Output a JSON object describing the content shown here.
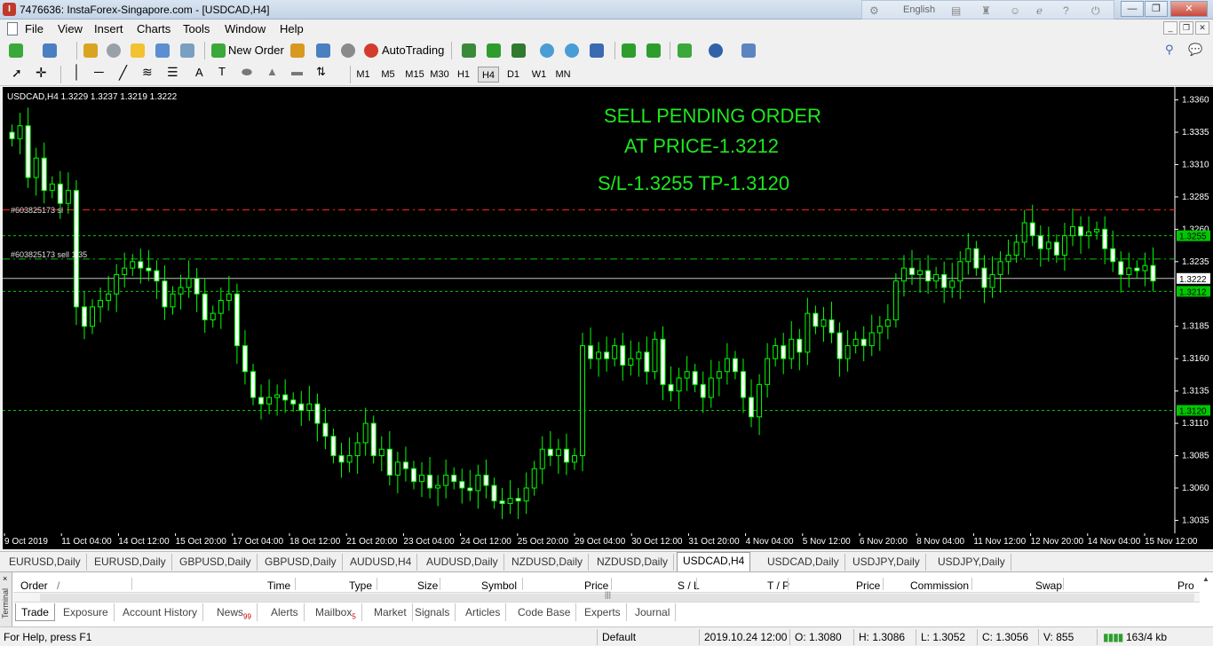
{
  "window": {
    "title": "7476636: InstaForex-Singapore.com - [USDCAD,H4]",
    "language": "English",
    "app_icon_letter": "I"
  },
  "menu": [
    "File",
    "View",
    "Insert",
    "Charts",
    "Tools",
    "Window",
    "Help"
  ],
  "toolbar": {
    "new_order": "New Order",
    "autotrading": "AutoTrading"
  },
  "timeframes": [
    "M1",
    "M5",
    "M15",
    "M30",
    "H1",
    "H4",
    "D1",
    "W1",
    "MN"
  ],
  "active_timeframe": "H4",
  "chart": {
    "symbol_info": "USDCAD,H4  1.3229 1.3237 1.3219 1.3222",
    "annotation_lines": [
      "SELL PENDING ORDER",
      "AT PRICE-1.3212",
      "S/L-1.3255 TP-1.3120"
    ],
    "order_sl_label": "#603825173 sl",
    "order_sell_label": "#603825173 sell 1.35",
    "price_ticks": [
      "1.3360",
      "1.3335",
      "1.3310",
      "1.3285",
      "1.3260",
      "1.3235",
      "1.3185",
      "1.3160",
      "1.3135",
      "1.3110",
      "1.3085",
      "1.3060",
      "1.3035"
    ],
    "price_labels": {
      "sl": "1.3255",
      "current": "1.3222",
      "entry": "1.3212",
      "tp": "1.3120"
    },
    "time_ticks": [
      "9 Oct 2019",
      "11 Oct 04:00",
      "14 Oct 12:00",
      "15 Oct 20:00",
      "17 Oct 04:00",
      "18 Oct 12:00",
      "21 Oct 20:00",
      "23 Oct 04:00",
      "24 Oct 12:00",
      "25 Oct 20:00",
      "29 Oct 04:00",
      "30 Oct 12:00",
      "31 Oct 20:00",
      "4 Nov 04:00",
      "5 Nov 12:00",
      "6 Nov 20:00",
      "8 Nov 04:00",
      "11 Nov 12:00",
      "12 Nov 20:00",
      "14 Nov 04:00",
      "15 Nov 12:00"
    ],
    "colors": {
      "background": "#000000",
      "candle": "#00ff00",
      "sl_line": "#ff2020",
      "level_line": "#00c800",
      "annotation": "#1ee81e",
      "price_line": "#c0c0c0"
    }
  },
  "chart_data": {
    "type": "candlestick",
    "symbol": "USDCAD",
    "timeframe": "H4",
    "levels": {
      "stop_loss": 1.3275,
      "sell_pending": 1.3237,
      "current_bid": 1.3222,
      "entry": 1.3212,
      "green_upper": 1.3255,
      "take_profit": 1.312
    },
    "ylim": [
      1.3025,
      1.337
    ],
    "closes": [
      1.333,
      1.334,
      1.33,
      1.3315,
      1.329,
      1.3295,
      1.328,
      1.329,
      1.32,
      1.3185,
      1.32,
      1.3205,
      1.321,
      1.3225,
      1.323,
      1.3235,
      1.323,
      1.3228,
      1.322,
      1.32,
      1.321,
      1.3215,
      1.3222,
      1.321,
      1.319,
      1.3195,
      1.3205,
      1.321,
      1.317,
      1.315,
      1.313,
      1.3125,
      1.313,
      1.3132,
      1.3128,
      1.3125,
      1.312,
      1.3125,
      1.311,
      1.31,
      1.3085,
      1.308,
      1.3085,
      1.3095,
      1.311,
      1.3085,
      1.309,
      1.307,
      1.308,
      1.3075,
      1.3065,
      1.307,
      1.306,
      1.3062,
      1.307,
      1.3065,
      1.306,
      1.3058,
      1.307,
      1.3062,
      1.305,
      1.3048,
      1.3052,
      1.305,
      1.306,
      1.3075,
      1.309,
      1.3085,
      1.309,
      1.308,
      1.3085,
      1.317,
      1.316,
      1.3165,
      1.316,
      1.317,
      1.3155,
      1.316,
      1.3165,
      1.315,
      1.3175,
      1.314,
      1.3135,
      1.3145,
      1.315,
      1.314,
      1.313,
      1.3145,
      1.315,
      1.316,
      1.315,
      1.313,
      1.3115,
      1.314,
      1.316,
      1.317,
      1.316,
      1.3175,
      1.3165,
      1.3195,
      1.3185,
      1.319,
      1.318,
      1.316,
      1.317,
      1.3175,
      1.317,
      1.318,
      1.3185,
      1.319,
      1.322,
      1.323,
      1.3225,
      1.3228,
      1.322,
      1.3225,
      1.3215,
      1.322,
      1.3235,
      1.3245,
      1.323,
      1.3215,
      1.3225,
      1.3235,
      1.324,
      1.325,
      1.3265,
      1.3255,
      1.3245,
      1.325,
      1.324,
      1.3255,
      1.3262,
      1.3255,
      1.3258,
      1.326,
      1.3245,
      1.3235,
      1.3225,
      1.323,
      1.3228,
      1.3232,
      1.322
    ]
  },
  "chart_tabs": [
    "EURUSD,Daily",
    "EURUSD,Daily",
    "GBPUSD,Daily",
    "GBPUSD,Daily",
    "AUDUSD,H4",
    "AUDUSD,Daily",
    "NZDUSD,Daily",
    "NZDUSD,Daily",
    "USDCAD,H4",
    "USDCAD,Daily",
    "USDJPY,Daily",
    "USDJPY,Daily"
  ],
  "active_chart_tab": "USDCAD,H4",
  "terminal": {
    "side_label": "Terminal",
    "columns": [
      "Order",
      "/",
      "Time",
      "Type",
      "Size",
      "Symbol",
      "Price",
      "S / L",
      "T / P",
      "Price",
      "Commission",
      "Swap",
      "Pro"
    ],
    "tabs": [
      "Trade",
      "Exposure",
      "Account History",
      "News",
      "Alerts",
      "Mailbox",
      "Market",
      "Signals",
      "Articles",
      "Code Base",
      "Experts",
      "Journal"
    ],
    "news_count": "99",
    "mailbox_count": "5",
    "active_tab": "Trade"
  },
  "status": {
    "help": "For Help, press F1",
    "profile": "Default",
    "datetime": "2019.10.24 12:00",
    "open": "O: 1.3080",
    "high": "H: 1.3086",
    "low": "L: 1.3052",
    "close": "C: 1.3056",
    "volume": "V: 855",
    "traffic": "163/4 kb"
  }
}
